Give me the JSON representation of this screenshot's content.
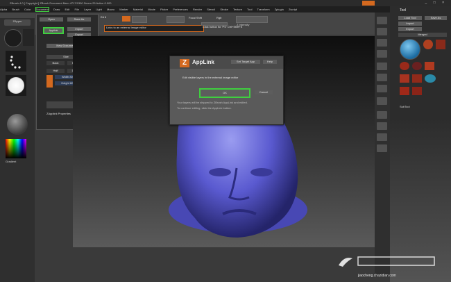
{
  "title_bar": {
    "text": "ZBrush 4.0  [ Copyright ]  ZBrush Document   Mem 4717/1300  Zmem 25   Active 0.000"
  },
  "menu_bar": {
    "items": [
      "Alpha",
      "Brush",
      "Color",
      "Document",
      "Draw",
      "Edit",
      "File",
      "Layer",
      "Light",
      "Macro",
      "Marker",
      "Material",
      "Movie",
      "Picker",
      "Preferences",
      "Render",
      "Stencil",
      "Stroke",
      "Texture",
      "Tool",
      "Transform",
      "Zplugin",
      "Zscript"
    ]
  },
  "top_right": {
    "button_label": "",
    "window_controls": "_ □ ×"
  },
  "notice": {
    "text": "Links to an external image editor",
    "hint": "Click button for 'PS' Ctrl+Shift+S"
  },
  "toolbar": {
    "group_label": "Ed it",
    "field_a": "Focal Shift",
    "field_b": "Rgb",
    "field_c": "Z Intensity"
  },
  "left_shelf": {
    "top_btn": "ZApper",
    "mid_label": "",
    "gradient_label": "Gradient"
  },
  "document_menu": {
    "open": "Open",
    "save": "Save As",
    "applink": "Applink",
    "import": "Import",
    "export": "Export",
    "new_document": "New Document",
    "size_label": "Size",
    "width": "Width 800",
    "height": "Height 600",
    "halftone": "Half",
    "double": "Double",
    "bg": "Back",
    "range": "Range",
    "subscript": "ZApplink Properties"
  },
  "dialog": {
    "title": "AppLink",
    "tab_set_target": "Set Target App",
    "tab_help": "Help",
    "message": "Edit visible layers in the external image editor",
    "ok_label": "OK",
    "cancel_label": "Cancel",
    "info_1": "Your layers will be shipped to ZBrush AppLink and edited.",
    "info_2": "To continue editing, click the AppLink button."
  },
  "right_tray": {
    "tool_title": "Tool",
    "load": "Load Tool",
    "save": "Save As",
    "import": "Import",
    "export": "Export",
    "active_tool": "Merged",
    "subtool_label": "SubTool",
    "watermark": "jiaocheng.chazidian.com"
  }
}
